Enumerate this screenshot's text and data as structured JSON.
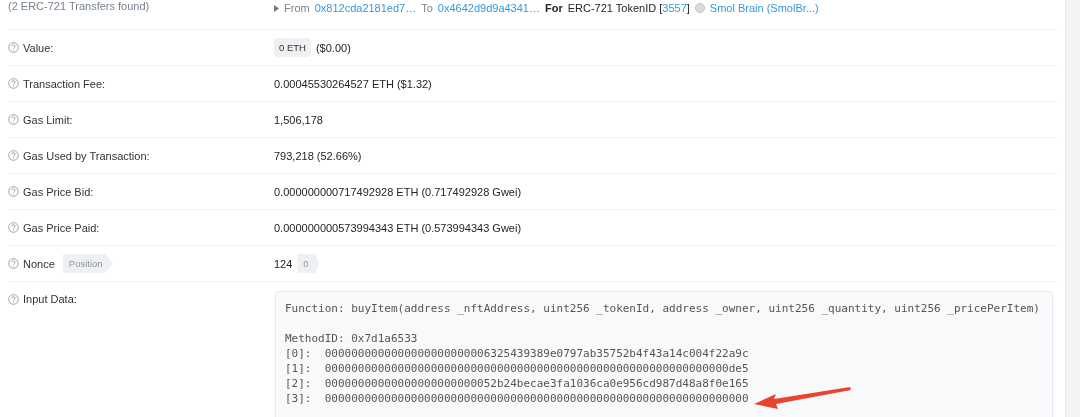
{
  "transfers_note": "(2 ERC-721 Transfers found)",
  "transfer": {
    "from_label": "From",
    "from": "0x812cda2181ed7…",
    "to_label": "To",
    "to": "0x4642d9d9a4341…",
    "for_label": "For",
    "token_label": "ERC-721 TokenID [",
    "token_id": "3557",
    "token_close": "]",
    "token_name": "Smol Brain (SmolBr...)"
  },
  "rows": [
    {
      "kind": "badge",
      "label": "Value:",
      "badge": "0 ETH",
      "value": "($0.00)"
    },
    {
      "kind": "text",
      "label": "Transaction Fee:",
      "value": "0.00045530264527 ETH ($1.32)"
    },
    {
      "kind": "text",
      "label": "Gas Limit:",
      "value": "1,506,178"
    },
    {
      "kind": "text",
      "label": "Gas Used by Transaction:",
      "value": "793,218 (52.66%)"
    },
    {
      "kind": "text",
      "label": "Gas Price Bid:",
      "value": "0.000000000717492928 ETH (0.717492928 Gwei)"
    },
    {
      "kind": "text",
      "label": "Gas Price Paid:",
      "value": "0.000000000573994343 ETH (0.573994343 Gwei)"
    },
    {
      "kind": "nonce",
      "label": "Nonce",
      "tag": "Position",
      "value": "124",
      "value_tag": "0"
    },
    {
      "kind": "input",
      "label": "Input Data:",
      "function": "Function: buyItem(address _nftAddress, uint256 _tokenId, address _owner, uint256 _quantity, uint256 _pricePerItem)",
      "method": "MethodID: 0x7d1a6533",
      "lines": [
        "[0]:  0000000000000000000000006325439389e0797ab35752b4f43a14c004f22a9c",
        "[1]:  0000000000000000000000000000000000000000000000000000000000000de5",
        "[2]:  00000000000000000000000052b24becae3fa1036ca0e956cd987d48a8f0e165",
        "[3]:  0000000000000000000000000000000000000000000000000000000000000000"
      ]
    }
  ]
}
